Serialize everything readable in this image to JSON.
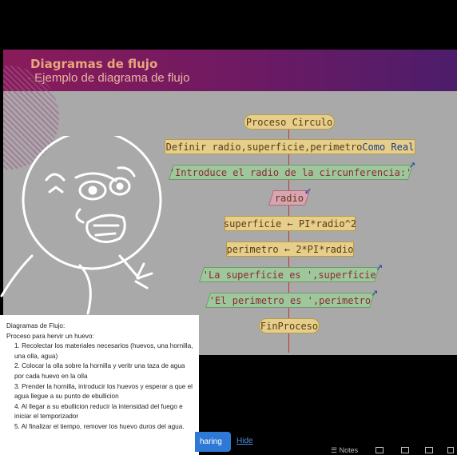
{
  "slide": {
    "title": "Diagramas de flujo",
    "subtitle": "· Ejemplo de diagrama de flujo"
  },
  "flowchart": {
    "start": "Proceso Circulo",
    "define_prefix": "Definir radio,superficie,perimetro ",
    "define_type": "Como Real",
    "prompt": "'Introduce el radio de la circunferencia:'",
    "input": "radio",
    "calc_area": "superficie ← PI*radio^2",
    "calc_perimeter": "perimetro ← 2*PI*radio",
    "out_area": "'La superficie es ',superficie",
    "out_perimeter": "'El perimetro es ',perimetro",
    "end": "FinProceso"
  },
  "notes": {
    "title": "Diagramas de Flujo:",
    "intro": "Proceso para hervir un huevo:",
    "steps": [
      "1. Recolectar los materiales necesarios (huevos, una hornilla, una olla, agua)",
      "2. Colocar la olla sobre la hornilla y veritr una taza de agua por cada huevo en la olla",
      "3. Prender la hornilla, introducir los huevos y esperar a que el agua llegue a su punto de ebullicion",
      "4. Al llegar a su ebullicion reducir la intensidad del fuego e iniciar el temporizador",
      "5. Al finalizar el tiempo, remover los huevo duros del agua."
    ]
  },
  "controls": {
    "share_label": "haring",
    "hide_label": "Hide",
    "notes_label": "Notes"
  },
  "colors": {
    "header_start": "#8a1b5a",
    "header_end": "#4c1d6b",
    "terminal": "#e6cf8a",
    "io_output": "#9ec79b",
    "io_input": "#d9a3b0",
    "share_button": "#2f79d6"
  }
}
